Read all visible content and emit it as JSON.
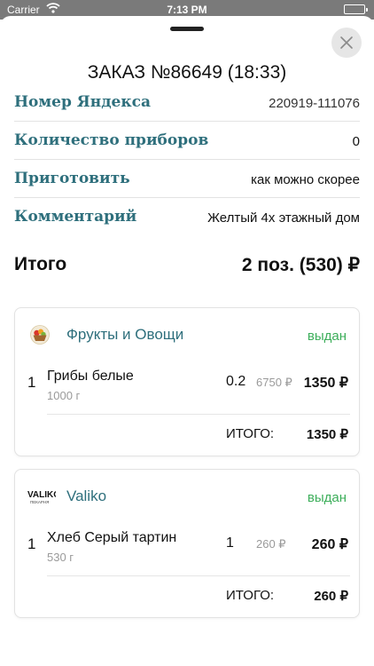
{
  "status_bar": {
    "carrier": "Carrier",
    "time": "7:13 PM"
  },
  "header": {
    "title": "ЗАКАЗ №86649 (18:33)",
    "close_icon": "close-icon"
  },
  "info": [
    {
      "label": "Номер Яндекса",
      "value": "220919-111076"
    },
    {
      "label": "Количество приборов",
      "value": "0"
    },
    {
      "label": "Приготовить",
      "value": "как можно скорее"
    },
    {
      "label": "Комментарий",
      "value": "Желтый 4х этажный дом"
    }
  ],
  "total": {
    "label": "Итого",
    "value": "2 поз. (530) ₽"
  },
  "colors": {
    "label": "#2e6f7c",
    "status": "#3cae5a"
  },
  "stores": [
    {
      "name": "Фрукты и Овощи",
      "logo_icon": "fruit-basket-icon",
      "status": "выдан",
      "items": [
        {
          "index": "1",
          "name": "Грибы белые",
          "unit": "1000 г",
          "qty": "0.2",
          "price": "6750 ₽",
          "sum": "1350 ₽"
        }
      ],
      "total_label": "ИТОГО:",
      "total_value": "1350 ₽"
    },
    {
      "name": "Valiko",
      "logo_icon": "valiko-logo-icon",
      "logo_text": "VALIKO",
      "logo_subtext": "ПЕКАРНЯ",
      "status": "выдан",
      "items": [
        {
          "index": "1",
          "name": "Хлеб Серый тартин",
          "unit": "530 г",
          "qty": "1",
          "price": "260 ₽",
          "sum": "260 ₽"
        }
      ],
      "total_label": "ИТОГО:",
      "total_value": "260 ₽"
    }
  ]
}
